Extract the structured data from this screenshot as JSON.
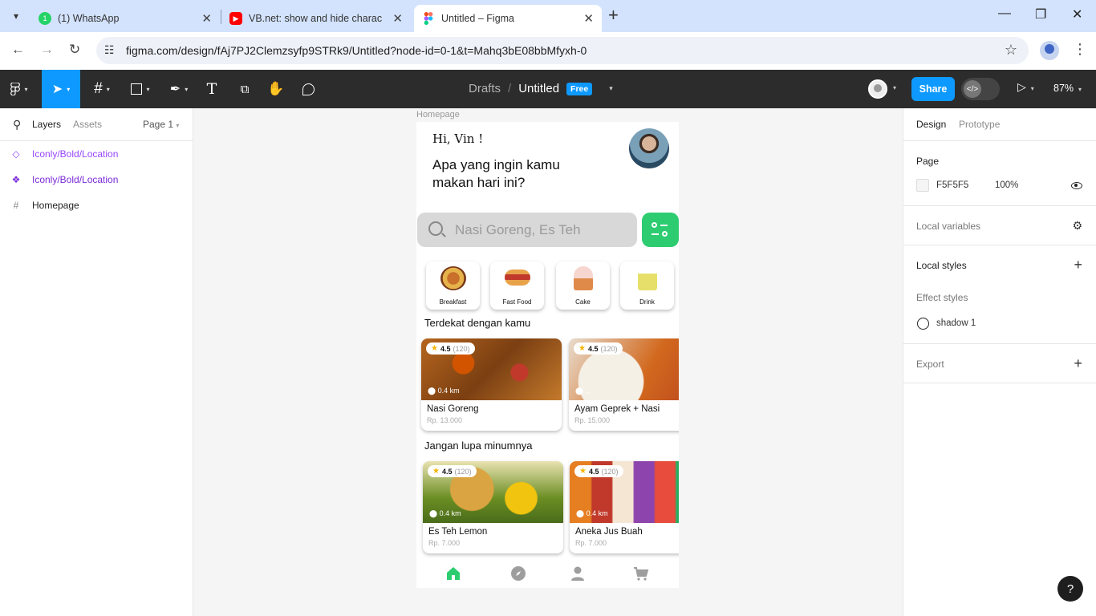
{
  "browser": {
    "tabs": [
      {
        "title": "(1) WhatsApp",
        "icon": "whatsapp-icon",
        "color": "#25d366"
      },
      {
        "title": "VB.net: show and hide characte",
        "icon": "youtube-icon",
        "color": "#ff0000"
      },
      {
        "title": "Untitled – Figma",
        "icon": "figma-icon",
        "color": "#f24e1e"
      }
    ],
    "url": "figma.com/design/fAj7PJ2Clemzsyfp9STRk9/Untitled?node-id=0-1&t=Mahq3bE08bbMfyxh-0"
  },
  "toolbar": {
    "breadcrumb_parent": "Drafts",
    "file_name": "Untitled",
    "plan_badge": "Free",
    "share_label": "Share",
    "zoom": "87%"
  },
  "left_panel": {
    "tabs": {
      "layers": "Layers",
      "assets": "Assets"
    },
    "page": "Page 1",
    "layers": [
      {
        "name": "Iconly/Bold/Location",
        "type": "component"
      },
      {
        "name": "Iconly/Bold/Location",
        "type": "component-main"
      },
      {
        "name": "Homepage",
        "type": "frame"
      }
    ]
  },
  "canvas": {
    "frame_label": "Homepage",
    "app": {
      "greeting": "Hi, Vin !",
      "headline": "Apa yang ingin kamu makan hari ini?",
      "search_placeholder": "Nasi Goreng, Es Teh",
      "categories": [
        "Breakfast",
        "Fast Food",
        "Cake",
        "Drink"
      ],
      "section_nearby": "Terdekat dengan kamu",
      "nearby": [
        {
          "rating": "4.5",
          "count": "(120)",
          "distance": "0.4 km",
          "name": "Nasi Goreng",
          "price": "Rp. 13.000"
        },
        {
          "rating": "4.5",
          "count": "(120)",
          "distance": "...",
          "name": "Ayam Geprek + Nasi",
          "price": "Rp. 15.000"
        }
      ],
      "section_drinks": "Jangan lupa minumnya",
      "drinks": [
        {
          "rating": "4.5",
          "count": "(120)",
          "distance": "0.4 km",
          "name": "Es Teh Lemon",
          "price": "Rp. 7.000"
        },
        {
          "rating": "4.5",
          "count": "(120)",
          "distance": "0.4 km",
          "name": "Aneka Jus Buah",
          "price": "Rp. 7.000"
        }
      ],
      "accent_color": "#2ecc71"
    }
  },
  "right_panel": {
    "tabs": {
      "design": "Design",
      "prototype": "Prototype"
    },
    "page_heading": "Page",
    "page_color": "F5F5F5",
    "page_opacity": "100%",
    "local_variables": "Local variables",
    "local_styles": "Local styles",
    "effect_styles": "Effect styles",
    "effect_style_name": "shadow 1",
    "export": "Export"
  }
}
